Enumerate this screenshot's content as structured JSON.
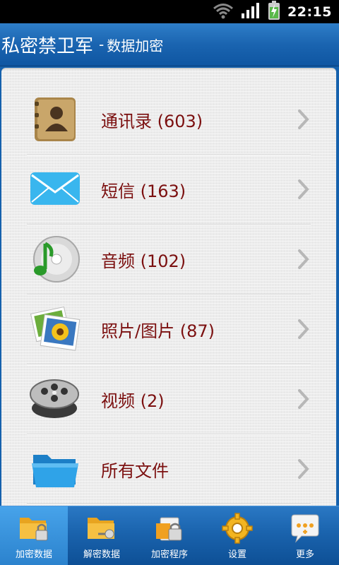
{
  "status_bar": {
    "time": "22:15",
    "icons": [
      "wifi-icon",
      "signal-icon",
      "battery-charging-icon"
    ]
  },
  "title_bar": {
    "app_name": "私密禁卫军",
    "separator": "-",
    "subtitle": "数据加密"
  },
  "list": {
    "items": [
      {
        "label": "通讯录 (603)",
        "icon": "contacts-book-icon"
      },
      {
        "label": "短信 (163)",
        "icon": "envelope-icon"
      },
      {
        "label": "音频 (102)",
        "icon": "music-disc-icon"
      },
      {
        "label": "照片/图片 (87)",
        "icon": "photos-icon"
      },
      {
        "label": "视频 (2)",
        "icon": "film-reel-icon"
      },
      {
        "label": "所有文件",
        "icon": "folder-icon"
      }
    ]
  },
  "tab_bar": {
    "active_index": 0,
    "tabs": [
      {
        "label": "加密数据",
        "icon": "encrypt-folder-icon"
      },
      {
        "label": "解密数据",
        "icon": "decrypt-folder-icon"
      },
      {
        "label": "加密程序",
        "icon": "encrypt-app-icon"
      },
      {
        "label": "设置",
        "icon": "settings-gear-icon"
      },
      {
        "label": "更多",
        "icon": "more-bubble-icon"
      }
    ]
  },
  "colors": {
    "title_bar": "#1a64b0",
    "item_text": "#7b0f0f",
    "tab_active": "#47a3ea"
  }
}
